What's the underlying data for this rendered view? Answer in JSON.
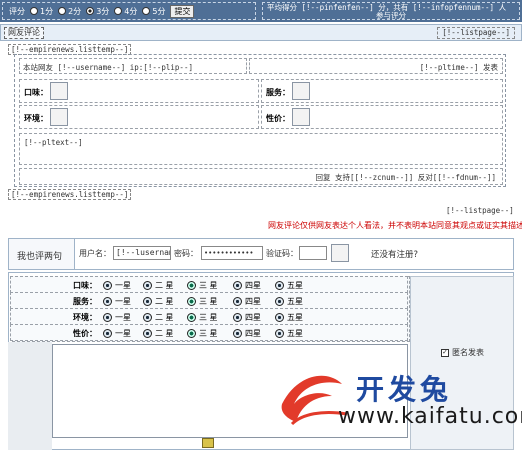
{
  "top": {
    "rate_label": "评分",
    "rate_options": [
      "1分",
      "2分",
      "3分",
      "4分",
      "5分"
    ],
    "selected_index": 2,
    "submit_label": "提交",
    "avg_line1": "平均得分  [!--pinfenfen--] 分，共有 [!--infopfennum--] 人",
    "avg_line2": "参与评分"
  },
  "comments_bar": {
    "title": "网友评论",
    "listpage": "[!--listpage--]"
  },
  "listtemp_tag": "[!--empirenews.listtemp--]",
  "comment": {
    "user_line": "本站网友 [!--username--] ip:[!--plip--]",
    "time_line": "[!--pltime--] 发表",
    "ratings": {
      "taste": "口味：",
      "service": "服务：",
      "environment": "环境：",
      "value": "性价："
    },
    "text": "[!--pltext--]",
    "actions": "回复  支持[[!--zcnum--]]  反对[[!--fdnum--]]"
  },
  "listpage_bottom": "[!--listpage--]",
  "notice": "网友评论仅供网友表达个人看法，并不表明本站同意其观点或证实其描述",
  "form": {
    "side_title": "我也评两句",
    "username_label": "用户名：",
    "username_value": "[!--lusername--]",
    "password_label": "密码：",
    "password_value": "••••••••••••",
    "captcha_label": "验证码：",
    "register_text": "还没有注册?"
  },
  "rating_rows": [
    {
      "label": "口味：",
      "selected": 2
    },
    {
      "label": "服务：",
      "selected": 2
    },
    {
      "label": "环境：",
      "selected": 2
    },
    {
      "label": "性价：",
      "selected": 2
    }
  ],
  "star_labels": [
    "一星",
    "二 星",
    "三 星",
    "四星",
    "五星"
  ],
  "anonymous_label": "匿名发表",
  "watermark": {
    "cn": "开发兔",
    "url": "www.kaifatu.com"
  }
}
